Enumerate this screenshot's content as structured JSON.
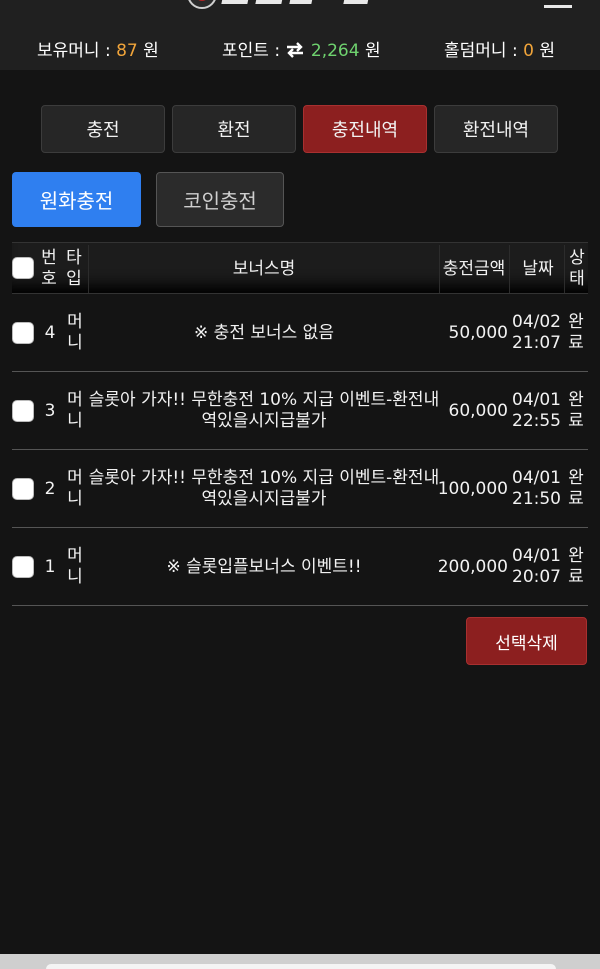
{
  "header": {
    "balance_label": "보유머니 :",
    "balance_value": "87",
    "balance_unit": "원",
    "point_label": "포인트 :",
    "point_icon": "exchange-arrows-icon",
    "point_value": "2,264",
    "point_unit": "원",
    "holdem_label": "홀덤머니 :",
    "holdem_value": "0",
    "holdem_unit": "원"
  },
  "tabs": [
    {
      "label": "충전",
      "active": false
    },
    {
      "label": "환전",
      "active": false
    },
    {
      "label": "충전내역",
      "active": true
    },
    {
      "label": "환전내역",
      "active": false
    }
  ],
  "sub_tabs": {
    "krw": "원화충전",
    "coin": "코인충전"
  },
  "table": {
    "headers": {
      "no": "번호",
      "type": "타입",
      "bonus": "보너스명",
      "amount": "충전금액",
      "date": "날짜",
      "status": "상태"
    },
    "rows": [
      {
        "no": "4",
        "type": "머니",
        "bonus": "※ 충전 보너스 없음",
        "amount": "50,000",
        "date": "04/02 21:07",
        "status": "완료"
      },
      {
        "no": "3",
        "type": "머니",
        "bonus": "슬롯아 가자!! 무한충전 10% 지급 이벤트-환전내역있을시지급불가",
        "amount": "60,000",
        "date": "04/01 22:55",
        "status": "완료"
      },
      {
        "no": "2",
        "type": "머니",
        "bonus": "슬롯아 가자!! 무한충전 10% 지급 이벤트-환전내역있을시지급불가",
        "amount": "100,000",
        "date": "04/01 21:50",
        "status": "완료"
      },
      {
        "no": "1",
        "type": "머니",
        "bonus": "※ 슬롯입플보너스 이벤트!!",
        "amount": "200,000",
        "date": "04/01 20:07",
        "status": "완료"
      }
    ]
  },
  "actions": {
    "delete_selected": "선택삭제"
  },
  "colors": {
    "accent_red": "#8c1f1f",
    "accent_blue": "#2f7ff0",
    "money_yellow": "#f0a43a",
    "point_green": "#6fd36f"
  }
}
